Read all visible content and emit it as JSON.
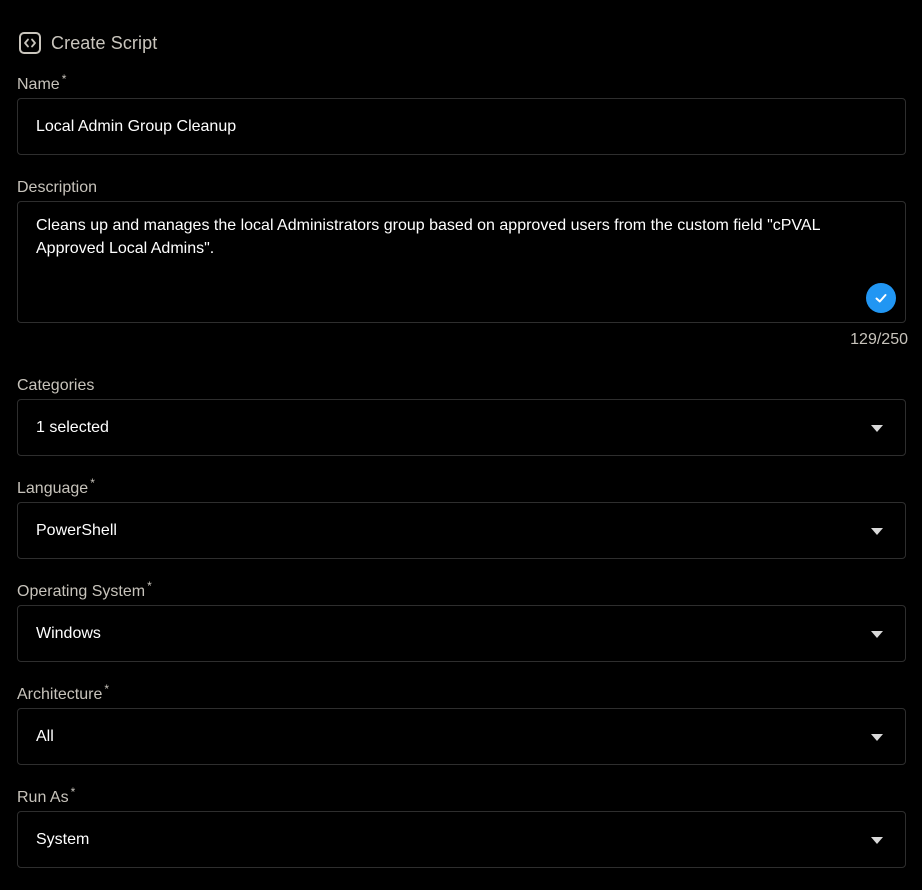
{
  "header": {
    "title": "Create Script",
    "icon": "code-icon"
  },
  "required_marker": "*",
  "name": {
    "label": "Name",
    "value": "Local Admin Group Cleanup"
  },
  "description": {
    "label": "Description",
    "value": "Cleans up and manages the local Administrators group based on approved users from the custom field \"cPVAL Approved Local Admins\".",
    "counter": "129/250",
    "check_color": "#2196f3"
  },
  "categories": {
    "label": "Categories",
    "value": "1 selected"
  },
  "language": {
    "label": "Language",
    "value": "PowerShell"
  },
  "operating_system": {
    "label": "Operating System",
    "value": "Windows"
  },
  "architecture": {
    "label": "Architecture",
    "value": "All"
  },
  "run_as": {
    "label": "Run As",
    "value": "System"
  }
}
